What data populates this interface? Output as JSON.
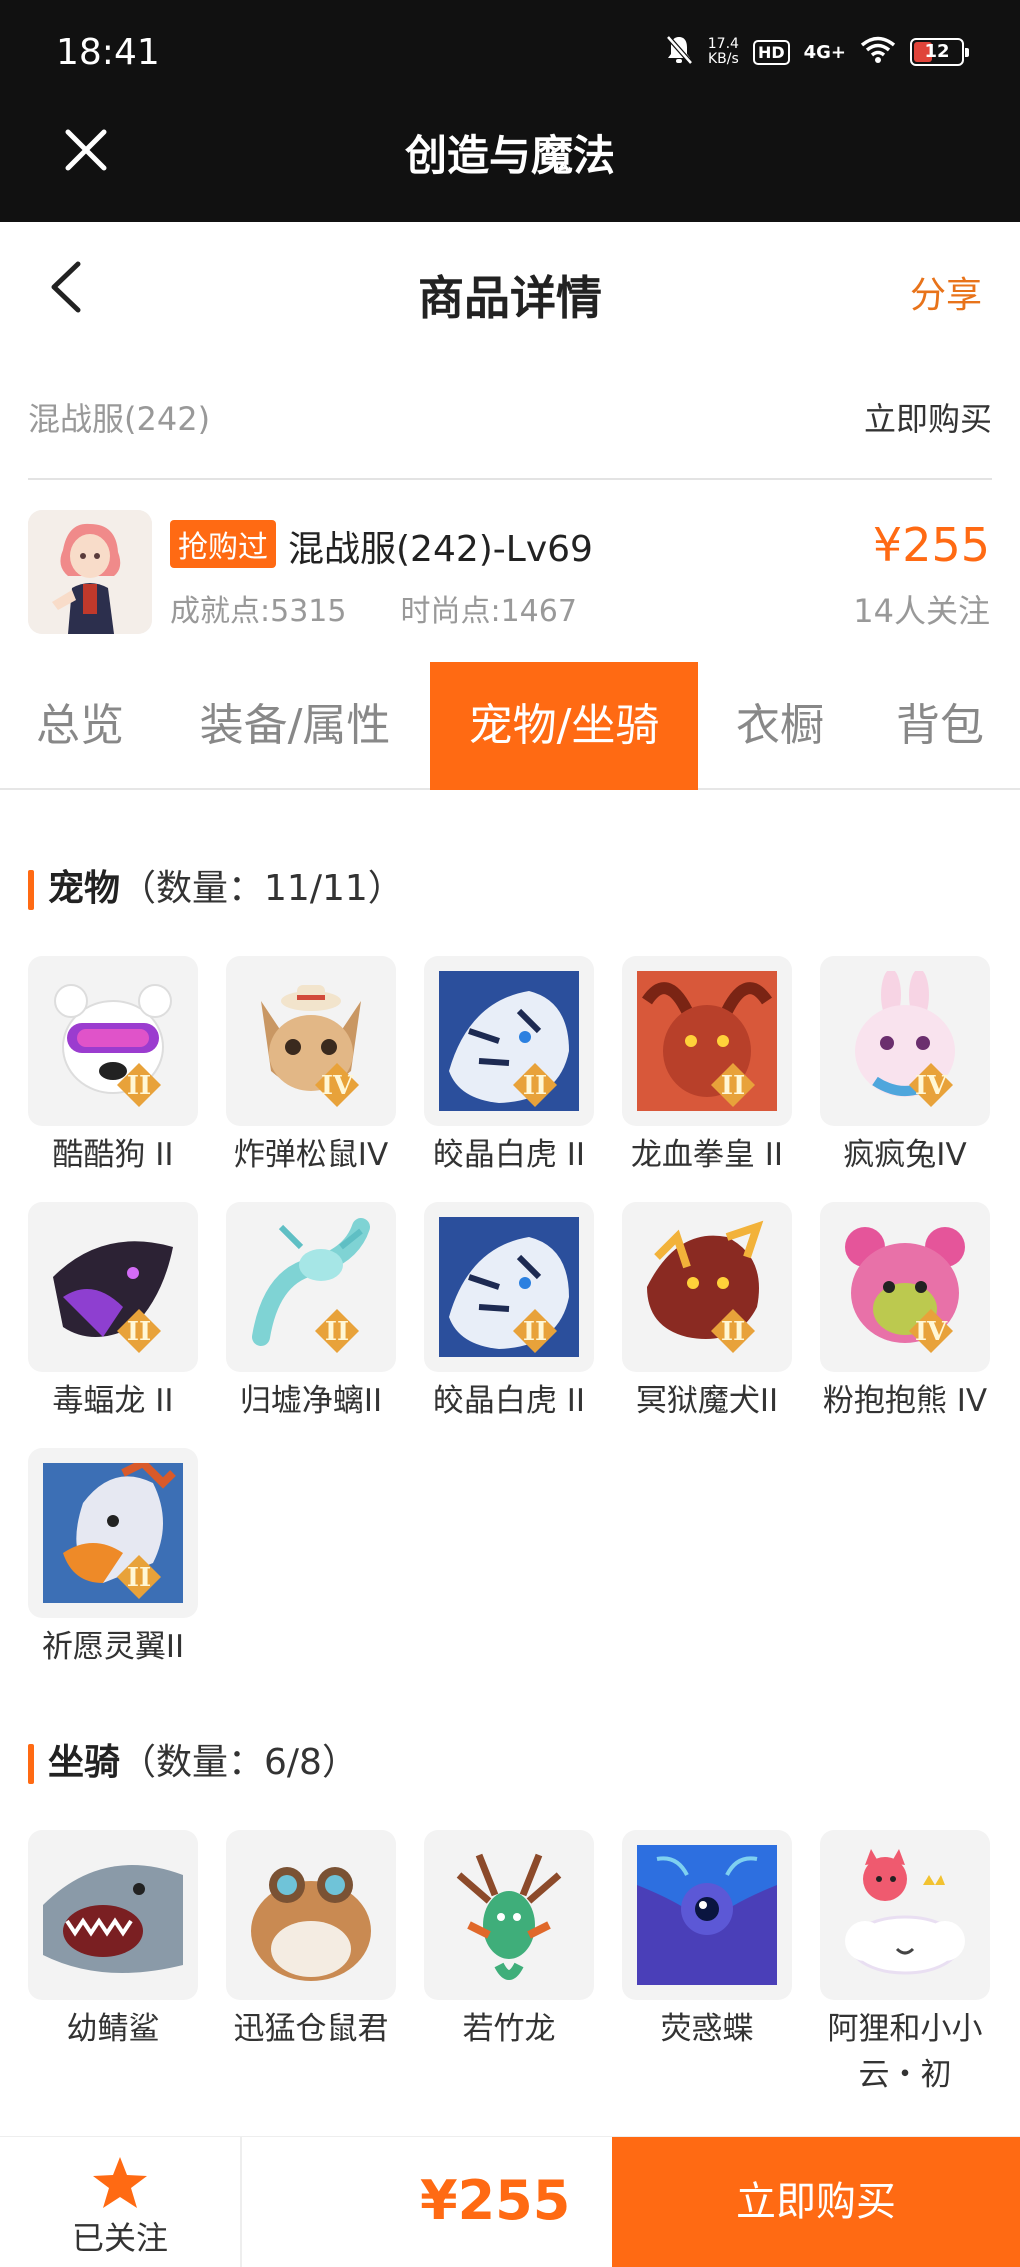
{
  "status_bar": {
    "time": "18:41",
    "net_speed_value": "17.4",
    "net_speed_unit": "KB/s",
    "hd": "HD",
    "signal": "4G+",
    "battery": "12",
    "icons": [
      "mute-bell-icon",
      "wifi-icon",
      "battery-icon"
    ]
  },
  "app": {
    "title": "创造与魔法",
    "close_icon": "close-icon"
  },
  "header": {
    "title": "商品详情",
    "share": "分享",
    "back_icon": "chevron-left-icon"
  },
  "server_row": {
    "server": "混战服(242)",
    "buy_now": "立即购买"
  },
  "product": {
    "tag": "抢购过",
    "name": "混战服(242)-Lv69",
    "achievement": "成就点:5315",
    "fashion": "时尚点:1467",
    "price": "¥255",
    "followers": "14人关注"
  },
  "tabs": [
    {
      "label": "总览",
      "active": false
    },
    {
      "label": "装备/属性",
      "active": false
    },
    {
      "label": "宠物/坐骑",
      "active": true
    },
    {
      "label": "衣橱",
      "active": false
    },
    {
      "label": "背包",
      "active": false
    }
  ],
  "pets_section": {
    "title": "宠物",
    "count": "（数量：11/11）",
    "items": [
      {
        "name": "酷酷狗 II",
        "grade": "II"
      },
      {
        "name": "炸弹松鼠IV",
        "grade": "IV"
      },
      {
        "name": "皎晶白虎 II",
        "grade": "II"
      },
      {
        "name": "龙血拳皇 II",
        "grade": "II"
      },
      {
        "name": "疯疯兔IV",
        "grade": "IV"
      },
      {
        "name": "毒蝠龙 II",
        "grade": "II"
      },
      {
        "name": "归墟净螭II",
        "grade": "II"
      },
      {
        "name": "皎晶白虎 II",
        "grade": "II"
      },
      {
        "name": "冥狱魔犬II",
        "grade": "II"
      },
      {
        "name": "粉抱抱熊 IV",
        "grade": "IV"
      },
      {
        "name": "祈愿灵翼II",
        "grade": "II"
      }
    ]
  },
  "mounts_section": {
    "title": "坐骑",
    "count": "（数量：6/8）",
    "items": [
      {
        "name": "幼鲭鲨"
      },
      {
        "name": "迅猛仓鼠君"
      },
      {
        "name": "若竹龙"
      },
      {
        "name": "荧惑蝶"
      },
      {
        "name": "阿狸和小小云・初",
        "line1": "阿狸和小小",
        "line2": "云・初"
      }
    ]
  },
  "bottom_bar": {
    "follow_label": "已关注",
    "price": "¥255",
    "buy_label": "立即购买",
    "star_icon": "star-icon"
  },
  "colors": {
    "accent": "#ff6a13",
    "share": "#e8731a",
    "dark_bar": "#111111"
  }
}
